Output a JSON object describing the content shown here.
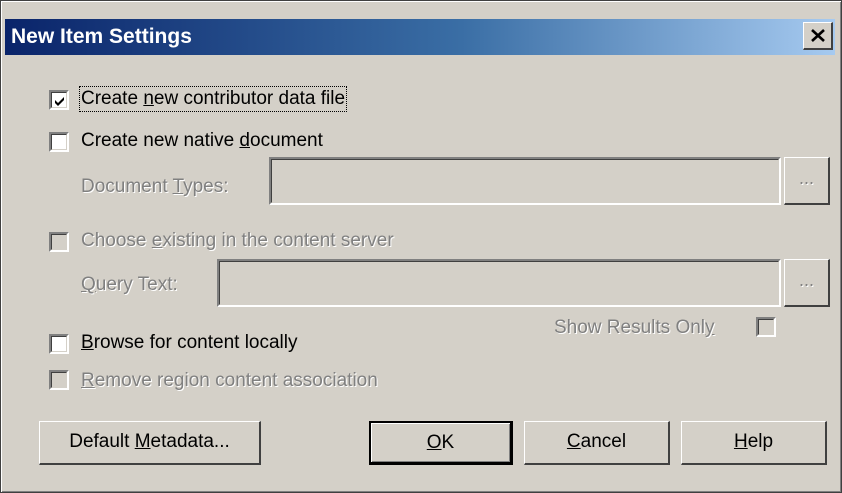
{
  "window": {
    "title": "New Item Settings",
    "close_glyph": "✕"
  },
  "options": {
    "create_contributor": {
      "label": "Create new contributor data file",
      "mnemonic": "n",
      "checked": true
    },
    "create_native": {
      "label": "Create new native document",
      "mnemonic": "d",
      "checked": false
    },
    "document_types": {
      "label": "Document Types:",
      "value": "",
      "browse_label": "..."
    },
    "choose_existing": {
      "label": "Choose existing in the content server",
      "checked": false,
      "enabled": false
    },
    "query_text": {
      "label": "Query Text:",
      "value": "",
      "browse_label": "..."
    },
    "show_results_only": {
      "label": "Show Results Only",
      "checked": false
    },
    "browse_local": {
      "label": "Browse for content locally",
      "checked": false
    },
    "remove_association": {
      "label": "Remove region content association",
      "checked": false,
      "enabled": false
    }
  },
  "buttons": {
    "default_metadata": "Default Metadata...",
    "ok": "OK",
    "cancel": "Cancel",
    "help": "Help"
  }
}
